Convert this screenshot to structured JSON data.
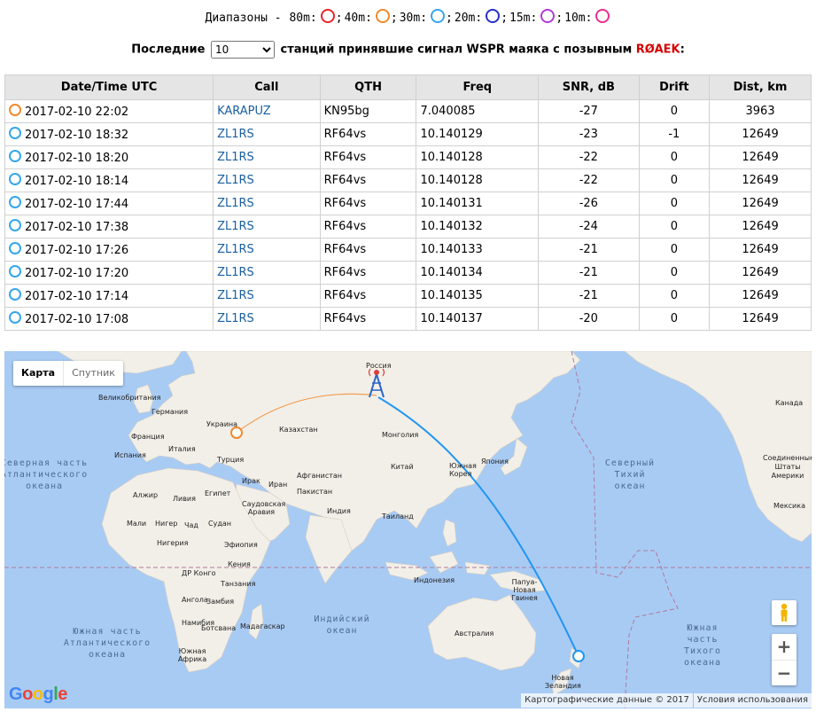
{
  "bands": {
    "prefix": "Диапазоны - ",
    "items": [
      {
        "label": "80m:",
        "color": "#e8252c"
      },
      {
        "label": "40m:",
        "color": "#f18a2e"
      },
      {
        "label": "30m:",
        "color": "#36a6ec"
      },
      {
        "label": "20m:",
        "color": "#2430c8"
      },
      {
        "label": "15m:",
        "color": "#b23bd0"
      },
      {
        "label": "10m:",
        "color": "#ec2e8c"
      }
    ]
  },
  "header": {
    "last_label": "Последние",
    "count_value": "10",
    "suffix": "станций принявшие сигнал WSPR маяка с позывным",
    "callsign": "RØAEK",
    "colon": ":"
  },
  "table": {
    "columns": [
      "Date/Time UTC",
      "Call",
      "QTH",
      "Freq",
      "SNR, dB",
      "Drift",
      "Dist, km"
    ],
    "rows": [
      {
        "time": "2017-02-10 22:02",
        "call": "KARAPUZ",
        "qth": "KN95bg",
        "freq": "7.040085",
        "snr": "-27",
        "drift": "0",
        "dist": "3963",
        "band_color": "#f18a2e"
      },
      {
        "time": "2017-02-10 18:32",
        "call": "ZL1RS",
        "qth": "RF64vs",
        "freq": "10.140129",
        "snr": "-23",
        "drift": "-1",
        "dist": "12649",
        "band_color": "#36a6ec"
      },
      {
        "time": "2017-02-10 18:20",
        "call": "ZL1RS",
        "qth": "RF64vs",
        "freq": "10.140128",
        "snr": "-22",
        "drift": "0",
        "dist": "12649",
        "band_color": "#36a6ec"
      },
      {
        "time": "2017-02-10 18:14",
        "call": "ZL1RS",
        "qth": "RF64vs",
        "freq": "10.140128",
        "snr": "-22",
        "drift": "0",
        "dist": "12649",
        "band_color": "#36a6ec"
      },
      {
        "time": "2017-02-10 17:44",
        "call": "ZL1RS",
        "qth": "RF64vs",
        "freq": "10.140131",
        "snr": "-26",
        "drift": "0",
        "dist": "12649",
        "band_color": "#36a6ec"
      },
      {
        "time": "2017-02-10 17:38",
        "call": "ZL1RS",
        "qth": "RF64vs",
        "freq": "10.140132",
        "snr": "-24",
        "drift": "0",
        "dist": "12649",
        "band_color": "#36a6ec"
      },
      {
        "time": "2017-02-10 17:26",
        "call": "ZL1RS",
        "qth": "RF64vs",
        "freq": "10.140133",
        "snr": "-21",
        "drift": "0",
        "dist": "12649",
        "band_color": "#36a6ec"
      },
      {
        "time": "2017-02-10 17:20",
        "call": "ZL1RS",
        "qth": "RF64vs",
        "freq": "10.140134",
        "snr": "-21",
        "drift": "0",
        "dist": "12649",
        "band_color": "#36a6ec"
      },
      {
        "time": "2017-02-10 17:14",
        "call": "ZL1RS",
        "qth": "RF64vs",
        "freq": "10.140135",
        "snr": "-21",
        "drift": "0",
        "dist": "12649",
        "band_color": "#36a6ec"
      },
      {
        "time": "2017-02-10 17:08",
        "call": "ZL1RS",
        "qth": "RF64vs",
        "freq": "10.140137",
        "snr": "-20",
        "drift": "0",
        "dist": "12649",
        "band_color": "#36a6ec"
      }
    ]
  },
  "map": {
    "type_map": "Карта",
    "type_satellite": "Спутник",
    "logo": "Google",
    "attribution": "Картографические данные © 2017",
    "terms": "Условия использования",
    "zoom_in": "+",
    "zoom_out": "−",
    "land_color": "#f2efe8",
    "water_color": "#a8cbf4",
    "path_40m_color": "#f18a2e",
    "path_30m_color": "#2196f3",
    "labels": {
      "russia": "Россия",
      "gb": "Великобритания",
      "germany": "Германия",
      "ukraine": "Украина",
      "france": "Франция",
      "spain": "Испания",
      "italy": "Италия",
      "turkey": "Турция",
      "kazakhstan": "Казахстан",
      "mongolia": "Монголия",
      "china": "Китай",
      "skorea": "Южная Корея",
      "japan": "Япония",
      "afghanistan": "Афганистан",
      "iran": "Иран",
      "iraq": "Ирак",
      "pakistan": "Пакистан",
      "india": "Индия",
      "thailand": "Таиланд",
      "indonesia": "Индонезия",
      "png": "Папуа-Новая Гвинея",
      "australia": "Австралия",
      "nz": "Новая Зеландия",
      "algeria": "Алжир",
      "libya": "Ливия",
      "egypt": "Египет",
      "saudi": "Саудовская Аравия",
      "mali": "Мали",
      "niger": "Нигер",
      "chad": "Чад",
      "sudan": "Судан",
      "nigeria": "Нигерия",
      "ethiopia": "Эфиопия",
      "kenya": "Кения",
      "drc": "ДР Конго",
      "tanzania": "Танзания",
      "angola": "Ангола",
      "zambia": "Замбия",
      "namibia": "Намибия",
      "botswana": "Ботсвана",
      "sa": "Южная Африка",
      "madagascar": "Мадагаскар",
      "canada": "Канада",
      "usa": "Соединенные Штаты Америки",
      "mexico": "Мексика",
      "n_atlantic": "Северная часть Атлантического океана",
      "n_pacific": "Северный Тихий океан",
      "indian": "Индийский океан",
      "s_atlantic": "Южная часть Атлантического океана",
      "s_pacific": "Южная часть Тихого океана"
    }
  }
}
